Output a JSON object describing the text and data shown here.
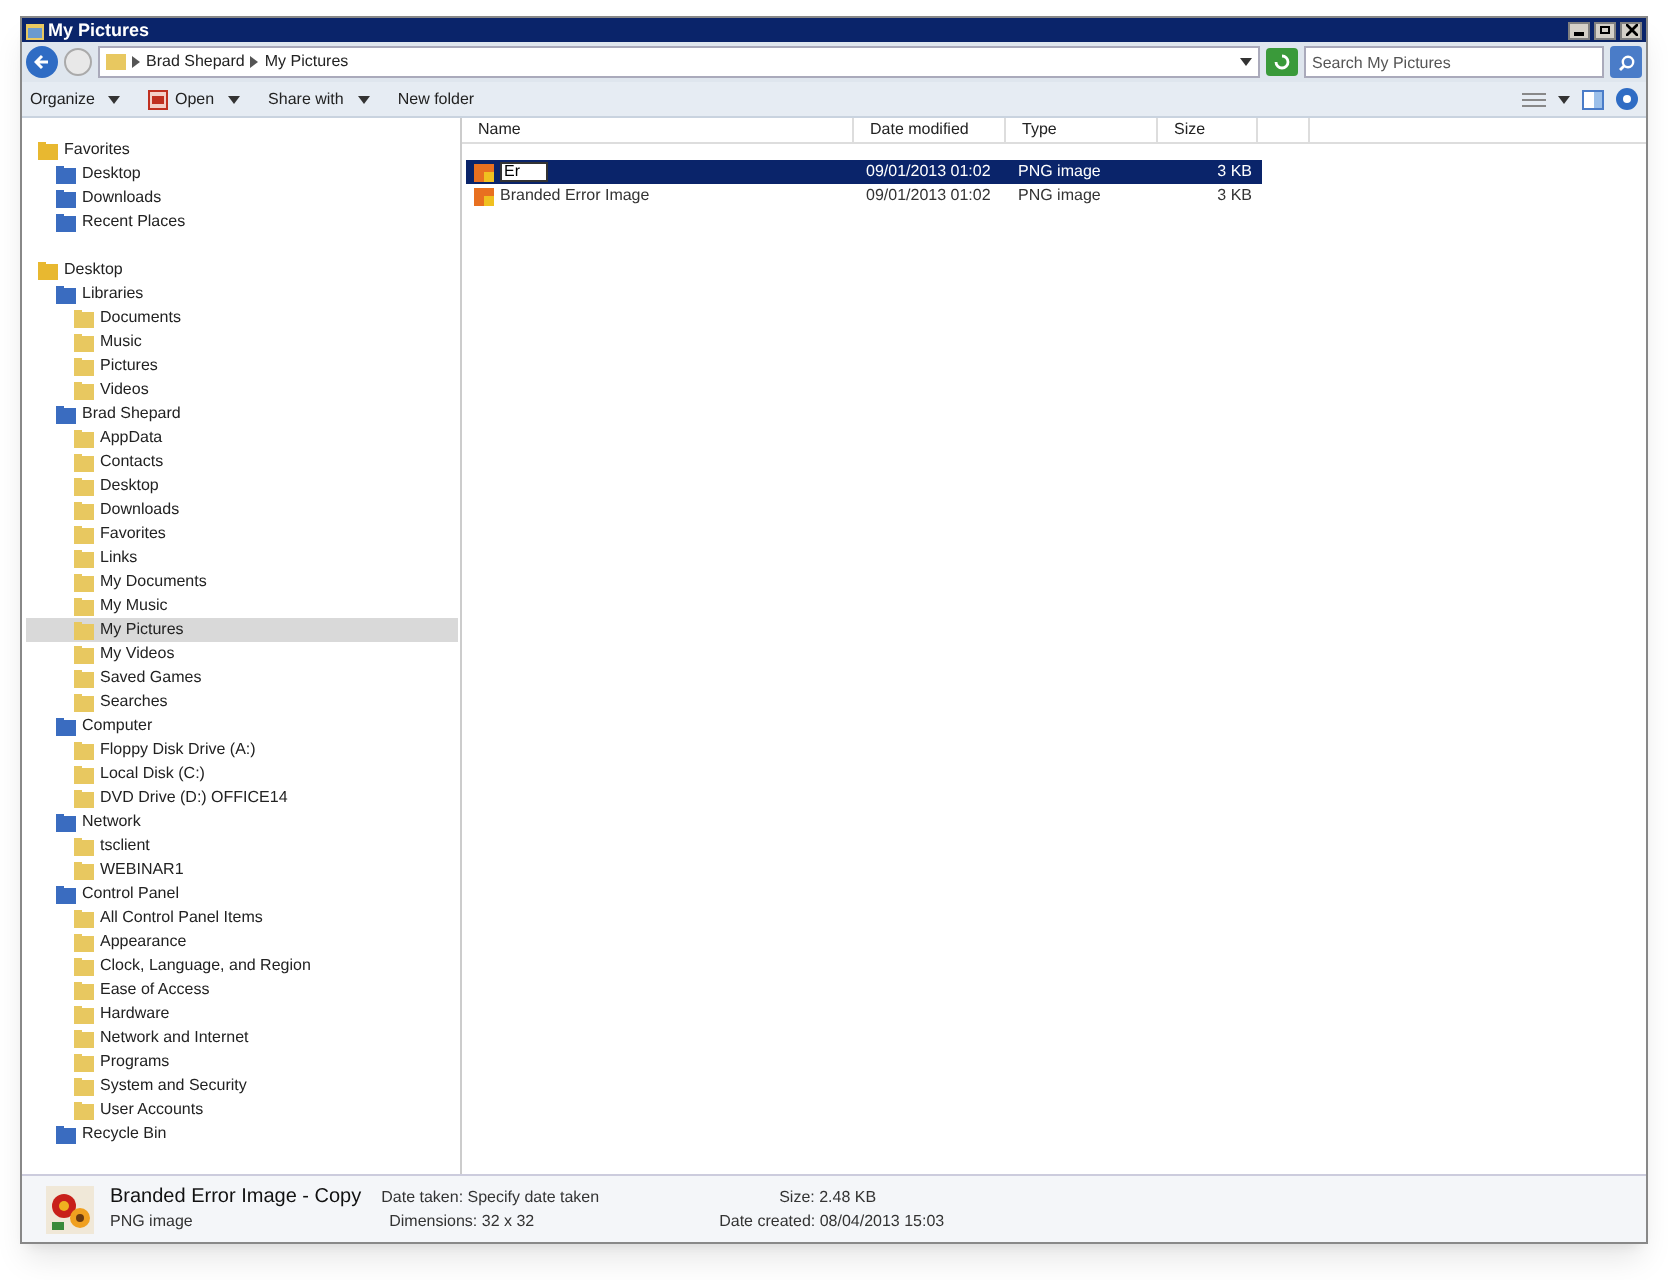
{
  "window": {
    "title": "My Pictures"
  },
  "address": {
    "crumbs": [
      "Brad Shepard",
      "My Pictures"
    ]
  },
  "search": {
    "placeholder": "Search My Pictures"
  },
  "toolbar": [
    {
      "label": "Organize",
      "dropdown": true,
      "icon": false
    },
    {
      "label": "Open",
      "dropdown": true,
      "icon": true
    },
    {
      "label": "Share with",
      "dropdown": true,
      "icon": false
    },
    {
      "label": "New folder",
      "dropdown": false,
      "icon": false
    }
  ],
  "nav": [
    {
      "label": "Favorites",
      "selected": false,
      "children": [
        {
          "label": "Desktop",
          "selected": false
        },
        {
          "label": "Downloads",
          "selected": false
        },
        {
          "label": "Recent Places",
          "selected": false
        }
      ]
    },
    {
      "label": "Desktop",
      "selected": false,
      "children": [
        {
          "label": "Libraries",
          "selected": false,
          "children": [
            {
              "label": "Documents",
              "selected": false
            },
            {
              "label": "Music",
              "selected": false
            },
            {
              "label": "Pictures",
              "selected": false
            },
            {
              "label": "Videos",
              "selected": false
            }
          ]
        },
        {
          "label": "Brad Shepard",
          "selected": false,
          "children": [
            {
              "label": "AppData",
              "selected": false
            },
            {
              "label": "Contacts",
              "selected": false
            },
            {
              "label": "Desktop",
              "selected": false
            },
            {
              "label": "Downloads",
              "selected": false
            },
            {
              "label": "Favorites",
              "selected": false
            },
            {
              "label": "Links",
              "selected": false
            },
            {
              "label": "My Documents",
              "selected": false
            },
            {
              "label": "My Music",
              "selected": false
            },
            {
              "label": "My Pictures",
              "selected": true
            },
            {
              "label": "My Videos",
              "selected": false
            },
            {
              "label": "Saved Games",
              "selected": false
            },
            {
              "label": "Searches",
              "selected": false
            }
          ]
        },
        {
          "label": "Computer",
          "selected": false,
          "children": [
            {
              "label": "Floppy Disk Drive (A:)",
              "selected": false
            },
            {
              "label": "Local Disk (C:)",
              "selected": false
            },
            {
              "label": "DVD Drive (D:) OFFICE14",
              "selected": false
            }
          ]
        },
        {
          "label": "Network",
          "selected": false,
          "children": [
            {
              "label": "tsclient",
              "selected": false
            },
            {
              "label": "WEBINAR1",
              "selected": false
            }
          ]
        },
        {
          "label": "Control Panel",
          "selected": false,
          "children": [
            {
              "label": "All Control Panel Items",
              "selected": false
            },
            {
              "label": "Appearance",
              "selected": false
            },
            {
              "label": "Clock, Language, and Region",
              "selected": false
            },
            {
              "label": "Ease of Access",
              "selected": false
            },
            {
              "label": "Hardware",
              "selected": false
            },
            {
              "label": "Network and Internet",
              "selected": false
            },
            {
              "label": "Programs",
              "selected": false
            },
            {
              "label": "System and Security",
              "selected": false
            },
            {
              "label": "User Accounts",
              "selected": false
            }
          ]
        },
        {
          "label": "Recycle Bin",
          "selected": false
        }
      ]
    }
  ],
  "table": {
    "columns": [
      "Name",
      "Date modified",
      "Type",
      "Size"
    ],
    "rows": [
      {
        "name": "Er",
        "editing": true,
        "selected": true,
        "date": "09/01/2013 01:02",
        "type": "PNG image",
        "size": "3 KB"
      },
      {
        "name": "Branded Error Image",
        "editing": false,
        "selected": false,
        "date": "09/01/2013 01:02",
        "type": "PNG image",
        "size": "3 KB"
      }
    ]
  },
  "details": {
    "name": "Branded Error Image - Copy",
    "type": "PNG image",
    "fields": [
      {
        "label": "Date taken:",
        "value": "Specify date taken"
      },
      {
        "label": "Size:",
        "value": "2.48 KB"
      },
      {
        "label": "Dimensions:",
        "value": "32 x 32"
      },
      {
        "label": "Date created:",
        "value": "08/04/2013 15:03"
      }
    ]
  }
}
